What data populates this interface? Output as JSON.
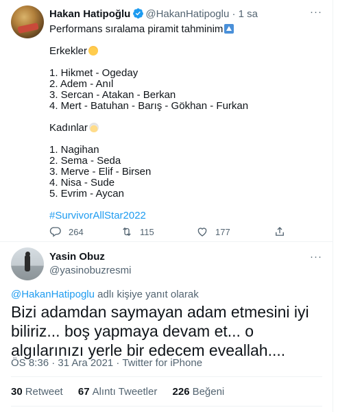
{
  "tweet1": {
    "author_name": "Hakan Hatipoğlu",
    "handle": "@HakanHatipoglu",
    "separator": "·",
    "time": "1 sa",
    "more": "···",
    "lines": [
      "Performans sıralama piramit tahminim",
      "",
      "Erkekler",
      "",
      "1. Hikmet - Ogeday",
      "2. Adem - Anıl",
      "3. Sercan - Atakan - Berkan",
      "4. Mert - Batuhan - Barış - Gökhan - Furkan",
      "",
      "Kadınlar",
      "",
      "1. Nagihan",
      "2. Sema - Seda",
      "3. Merve - Elif - Birsen",
      "4. Nisa - Sude",
      "5. Evrim - Aycan",
      ""
    ],
    "hashtag": "#SurvivorAllStar2022",
    "reply_count": "264",
    "retweet_count": "115",
    "like_count": "177"
  },
  "tweet2": {
    "author_name": "Yasin Obuz",
    "handle": "@yasinobuzresmi",
    "more": "···",
    "replying_mention": "@HakanHatipoglu",
    "replying_suffix": " adlı kişiye yanıt olarak",
    "text": "Bizi adamdan saymayan adam etmesini iyi biliriz... boş yapmaya devam et... o algılarınızı yerle bir edecem eveallah....",
    "meta": "ÖS 8:36 · 31 Ara 2021 · Twitter for iPhone",
    "retweets": "30",
    "retweets_label": "Retweet",
    "quotes": "67",
    "quotes_label": "Alıntı Tweetler",
    "likes": "226",
    "likes_label": "Beğeni"
  },
  "colors": {
    "text": "#0f1419",
    "muted": "#536471",
    "accent": "#1d9bf0",
    "divider": "#eff3f4"
  },
  "icons": [
    "verified-badge-icon",
    "more-icon",
    "reply-icon",
    "retweet-icon",
    "like-icon",
    "share-icon",
    "pyramid-emoji-icon",
    "man-emoji-icon",
    "woman-emoji-icon"
  ]
}
